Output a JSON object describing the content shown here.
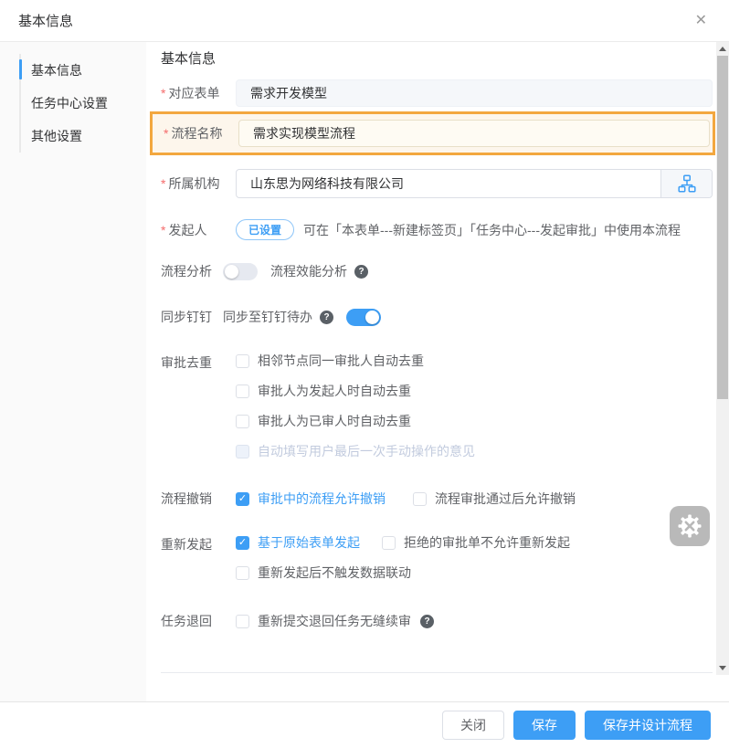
{
  "dialog": {
    "title": "基本信息",
    "close_glyph": "✕"
  },
  "required_marker": "*",
  "sidebar": {
    "items": [
      {
        "label": "基本信息",
        "active": true
      },
      {
        "label": "任务中心设置",
        "active": false
      },
      {
        "label": "其他设置",
        "active": false
      }
    ]
  },
  "content": {
    "heading": "基本信息",
    "fields": {
      "form": {
        "label": "对应表单",
        "required": true,
        "value": "需求开发模型",
        "disabled": true
      },
      "process_name": {
        "label": "流程名称",
        "required": true,
        "value": "需求实现模型流程",
        "highlighted": true
      },
      "organization": {
        "label": "所属机构",
        "required": true,
        "value": "山东思为网络科技有限公司",
        "picker_icon": "org-chart"
      },
      "initiator": {
        "label": "发起人",
        "required": true,
        "badge": "已设置",
        "hint": "可在「本表单---新建标签页」「任务中心---发起审批」中使用本流程"
      },
      "analysis": {
        "label": "流程分析",
        "toggle_on": false,
        "toggle_label": "流程效能分析",
        "has_help": true
      },
      "dingtalk": {
        "label": "同步钉钉",
        "toggle_label": "同步至钉钉待办",
        "has_help": true,
        "toggle_on": true
      },
      "dedup": {
        "label": "审批去重",
        "options": [
          {
            "label": "相邻节点同一审批人自动去重",
            "checked": false,
            "disabled": false
          },
          {
            "label": "审批人为发起人时自动去重",
            "checked": false,
            "disabled": false
          },
          {
            "label": "审批人为已审人时自动去重",
            "checked": false,
            "disabled": false
          },
          {
            "label": "自动填写用户最后一次手动操作的意见",
            "checked": false,
            "disabled": true
          }
        ]
      },
      "revoke": {
        "label": "流程撤销",
        "options": [
          {
            "label": "审批中的流程允许撤销",
            "checked": true
          },
          {
            "label": "流程审批通过后允许撤销",
            "checked": false
          }
        ]
      },
      "reinitiate": {
        "label": "重新发起",
        "options": [
          {
            "label": "基于原始表单发起",
            "checked": true
          },
          {
            "label": "拒绝的审批单不允许重新发起",
            "checked": false
          },
          {
            "label": "重新发起后不触发数据联动",
            "checked": false
          }
        ]
      },
      "task_return": {
        "label": "任务退回",
        "options": [
          {
            "label": "重新提交退回任务无缝续审",
            "checked": false,
            "has_help": true
          }
        ]
      }
    }
  },
  "footer": {
    "buttons": [
      {
        "label": "关闭",
        "type": "default"
      },
      {
        "label": "保存",
        "type": "primary"
      },
      {
        "label": "保存并设计流程",
        "type": "primary"
      }
    ]
  },
  "colors": {
    "primary": "#3d9ef5",
    "highlight_border": "#f3a73f",
    "highlight_bg": "#fdf6ec",
    "required": "#f56c6c"
  }
}
